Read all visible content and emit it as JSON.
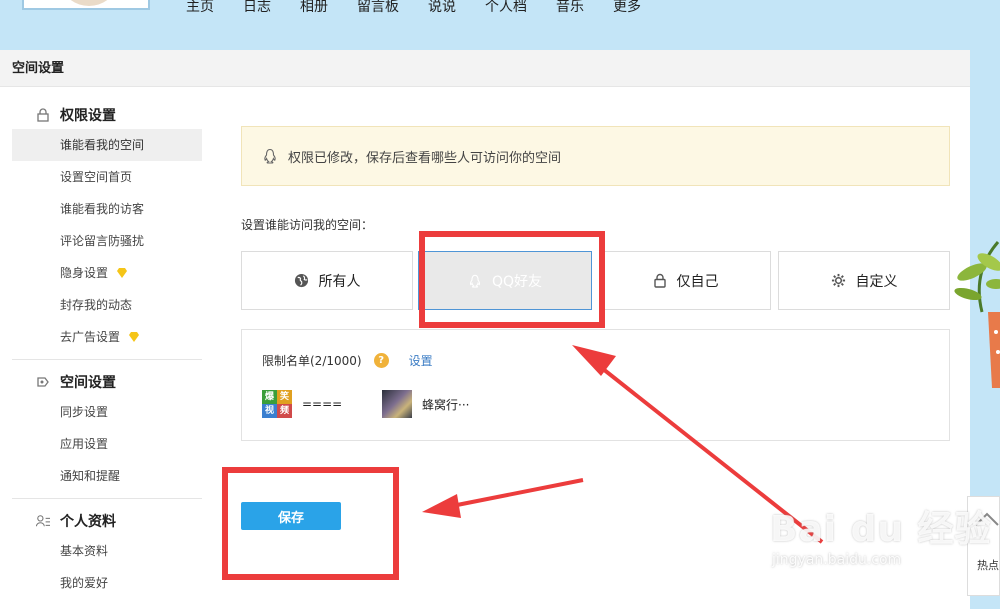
{
  "topnav": [
    "主页",
    "日志",
    "相册",
    "留言板",
    "说说",
    "个人档",
    "音乐",
    "更多"
  ],
  "panel_title": "空间设置",
  "sidebar": {
    "sections": [
      {
        "title": "权限设置",
        "icon": "lock-icon",
        "items": [
          {
            "label": "谁能看我的空间",
            "active": true
          },
          {
            "label": "设置空间首页"
          },
          {
            "label": "谁能看我的访客"
          },
          {
            "label": "评论留言防骚扰"
          },
          {
            "label": "隐身设置",
            "badge": "diamond-icon"
          },
          {
            "label": "封存我的动态"
          },
          {
            "label": "去广告设置",
            "badge": "diamond-icon"
          }
        ]
      },
      {
        "title": "空间设置",
        "icon": "space-settings-icon",
        "items": [
          {
            "label": "同步设置"
          },
          {
            "label": "应用设置"
          },
          {
            "label": "通知和提醒"
          }
        ]
      },
      {
        "title": "个人资料",
        "icon": "profile-icon",
        "items": [
          {
            "label": "基本资料"
          },
          {
            "label": "我的爱好"
          }
        ]
      }
    ]
  },
  "notice": "权限已修改，保存后查看哪些人可访问你的空间",
  "access_label": "设置谁能访问我的空间：",
  "options": [
    {
      "label": "所有人",
      "icon": "globe-icon"
    },
    {
      "label": "QQ好友",
      "icon": "qq-penguin-icon",
      "selected": true
    },
    {
      "label": "仅自己",
      "icon": "lock-icon"
    },
    {
      "label": "自定义",
      "icon": "gear-icon"
    }
  ],
  "restrict_list": {
    "title": "限制名单(2/1000)",
    "help": "?",
    "settings_link": "设置",
    "entries": [
      {
        "name": "====",
        "thumb_text": [
          "爆",
          "笑",
          "视",
          "频"
        ]
      },
      {
        "name": "蜂窝行···"
      }
    ]
  },
  "save_label": "保存",
  "back_top": {
    "label": "热点"
  },
  "watermark": {
    "logo": "Bai du 经验",
    "url": "jingyan.baidu.com"
  },
  "colors": {
    "page_bg": "#c4e5f7",
    "accent_blue": "#2aa3e8",
    "annotation_red": "#ec3c3c",
    "notice_bg": "#fdf8e4",
    "selected_border": "#4f95d6"
  }
}
